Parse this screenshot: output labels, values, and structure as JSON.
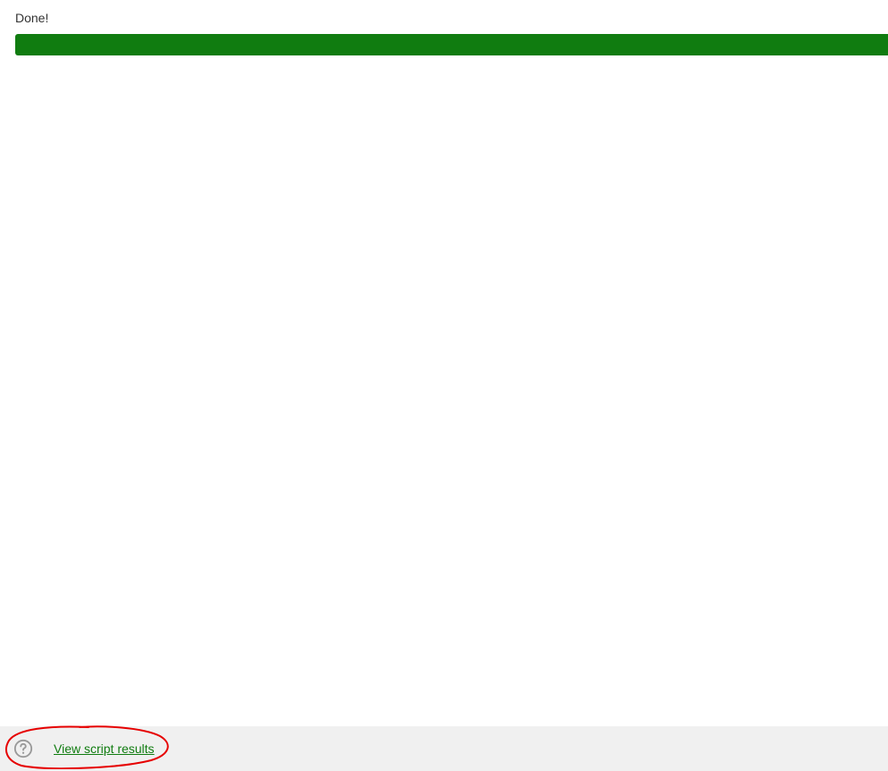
{
  "status": {
    "label": "Done!"
  },
  "progress": {
    "percent": 100,
    "color": "#107C10"
  },
  "footer": {
    "help_icon": "help-circle",
    "results_link_label": "View script results"
  },
  "annotation": {
    "color": "#e60000",
    "description": "hand-drawn-circle"
  }
}
